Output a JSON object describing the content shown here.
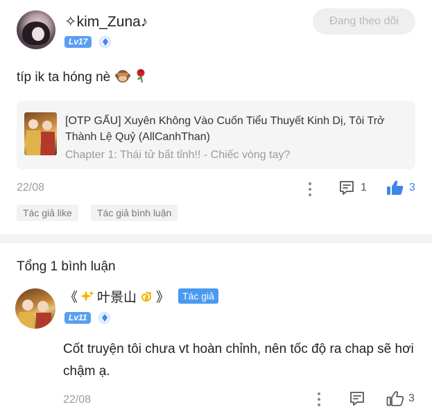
{
  "post": {
    "username": "✧kim_Zuna♪",
    "level": "Lv17",
    "follow_label": "Đang theo dõi",
    "text": "típ ik ta hóng nè",
    "emoji": [
      "monkey-see-no-evil",
      "rose"
    ],
    "book": {
      "title": "[OTP GẤU] Xuyên Không Vào Cuốn Tiểu Thuyết Kinh Dị, Tôi Trở Thành Lệ Quỷ (AllCanhThan)",
      "chapter": "Chapter 1: Thái tử bất tỉnh!! - Chiếc vòng tay?"
    },
    "date": "22/08",
    "comment_count": "1",
    "like_count": "3",
    "tags": [
      "Tác giả like",
      "Tác giả bình luận"
    ]
  },
  "comments": {
    "total_label": "Tổng 1 bình luận",
    "items": [
      {
        "name_prefix": "《",
        "name_main": "叶景山",
        "name_suffix": "》",
        "author_tag": "Tác giả",
        "level": "Lv11",
        "text": "Cốt truyện tôi chưa vt hoàn chỉnh, nên tốc độ ra chap sẽ hơi chậm ạ.",
        "date": "22/08",
        "like_count": "3"
      }
    ]
  },
  "colors": {
    "accent": "#4a9af0",
    "level_badge": "#5b9ef2",
    "muted": "#9a9a9a"
  }
}
